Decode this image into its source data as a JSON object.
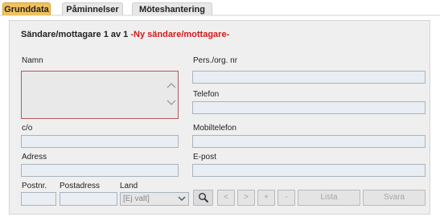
{
  "tabs": [
    {
      "label": "Grunddata",
      "active": true
    },
    {
      "label": "Påminnelser",
      "active": false
    },
    {
      "label": "Möteshantering",
      "active": false
    }
  ],
  "header": {
    "title": "Sändare/mottagare 1 av 1",
    "new_link": "-Ny sändare/mottagare-"
  },
  "left": {
    "name_label": "Namn",
    "co_label": "c/o",
    "address_label": "Adress",
    "postnr_label": "Postnr.",
    "postadress_label": "Postadress",
    "land_label": "Land",
    "land_value": "[Ej valt]"
  },
  "right": {
    "pers_label": "Pers./org. nr",
    "phone_label": "Telefon",
    "mobile_label": "Mobiltelefon",
    "email_label": "E-post"
  },
  "buttons": {
    "prev": "<",
    "next": ">",
    "add": "+",
    "remove": "-",
    "list": "Lista",
    "reply": "Svara"
  },
  "icons": {
    "search": "magnifier-icon",
    "scroll_up": "chevron-up-icon",
    "scroll_down": "chevron-down-icon",
    "dropdown": "chevron-down-icon"
  },
  "colors": {
    "active_tab": "#f2c15d",
    "new_link": "#d11a1a",
    "name_border": "#b25a5a",
    "field_bg": "#e8eef3"
  }
}
